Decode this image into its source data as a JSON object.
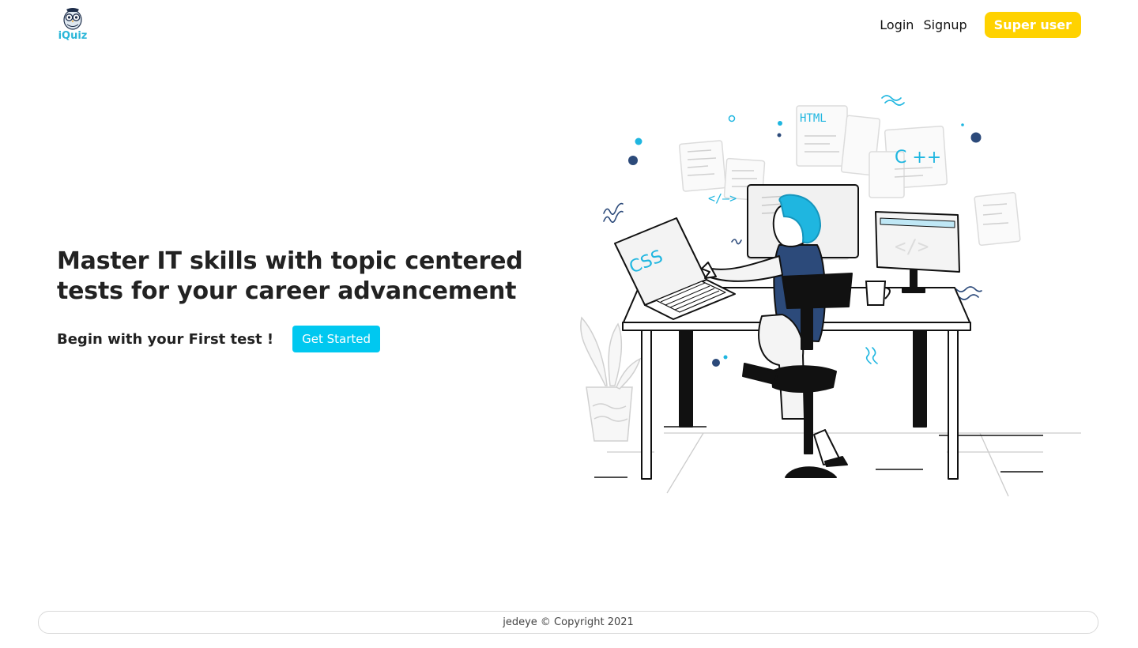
{
  "header": {
    "logo_text": "iQuiz",
    "nav": {
      "login": "Login",
      "signup": "Signup",
      "super_user": "Super user"
    }
  },
  "hero": {
    "title_line1": "Master IT skills with topic centered",
    "title_line2": "tests for your career advancement",
    "subtitle": "Begin with your First test !",
    "cta": "Get Started"
  },
  "illustration": {
    "labels": {
      "html": "HTML",
      "cpp": "C ++",
      "css": "CSS",
      "tag": "</–>",
      "code": "</>"
    }
  },
  "footer": {
    "copyright": "jedeye © Copyright 2021"
  },
  "colors": {
    "accent_cyan": "#00c8f0",
    "accent_yellow": "#ffd200",
    "navy": "#2c4a7a"
  }
}
